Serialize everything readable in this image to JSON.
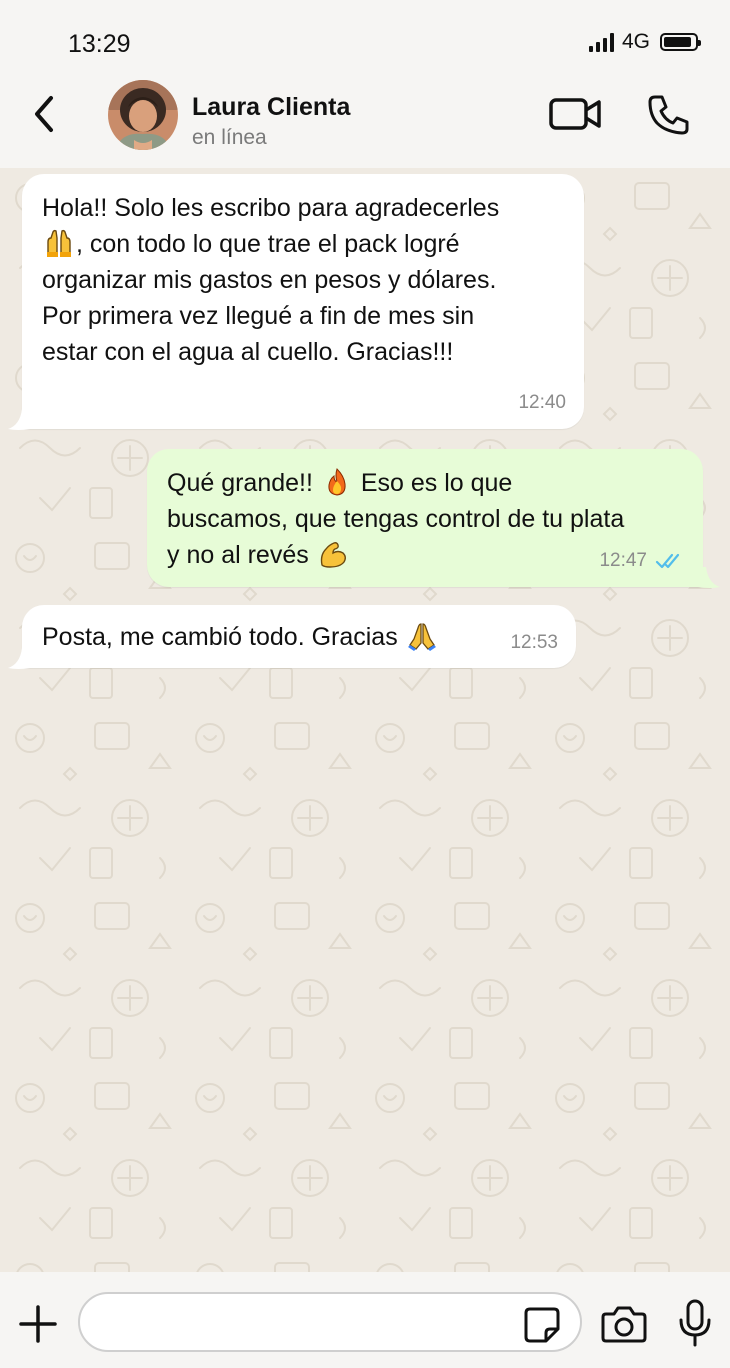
{
  "status_bar": {
    "time": "13:29",
    "network": "4G",
    "battery_level": 0.9
  },
  "header": {
    "contact_name": "Laura Clienta",
    "contact_status": "en línea",
    "icons": [
      "back-chevron-icon",
      "avatar-photo",
      "video-call-icon",
      "phone-call-icon"
    ]
  },
  "messages": [
    {
      "direction": "incoming",
      "lines": [
        "Hola!! Solo les escribo para agradecerles",
        ", con todo lo que trae el pack logré",
        "organizar mis gastos en pesos y dólares.",
        "Por primera vez llegué a fin de mes sin",
        "estar con el agua al cuello. Gracias!!!"
      ],
      "emoji": "raising-hands-emoji",
      "time": "12:40"
    },
    {
      "direction": "outgoing",
      "lines": [
        "Qué grande!! ",
        " Eso es lo que",
        "buscamos, que tengas control de tu plata",
        "y no al revés "
      ],
      "emojis": [
        "fire-emoji",
        "flexed-biceps-emoji"
      ],
      "time": "12:47",
      "read": true
    },
    {
      "direction": "incoming",
      "lines": [
        "Posta, me cambió todo. Gracias "
      ],
      "emoji": "folded-hands-emoji",
      "time": "12:53"
    }
  ],
  "input_bar": {
    "value": "",
    "icons": [
      "plus-icon",
      "sticker-icon",
      "camera-icon",
      "microphone-icon"
    ]
  },
  "colors": {
    "chat_background": "#efeae2",
    "incoming_bubble": "#ffffff",
    "outgoing_bubble": "#e7fcd7",
    "read_ticks": "#53bdeb",
    "bar_background": "#f6f5f3"
  }
}
